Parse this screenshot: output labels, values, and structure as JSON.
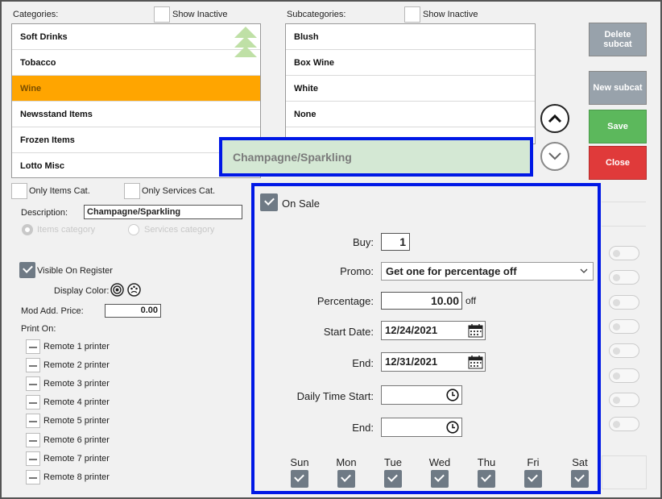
{
  "categories": {
    "header": "Categories:",
    "show_inactive": "Show Inactive",
    "items": [
      "Soft Drinks",
      "Tobacco",
      "Wine",
      "Newsstand Items",
      "Frozen Items",
      "Lotto Misc"
    ],
    "selected": "Wine"
  },
  "subcategories": {
    "header": "Subcategories:",
    "show_inactive": "Show Inactive",
    "items": [
      "Blush",
      "Box Wine",
      "White",
      "None"
    ]
  },
  "buttons": {
    "delete_subcat": "Delete subcat",
    "new_subcat": "New subcat",
    "save": "Save",
    "close": "Close"
  },
  "selected_subcat_banner": "Champagne/Sparkling",
  "filters": {
    "only_items": "Only Items Cat.",
    "only_services": "Only Services Cat."
  },
  "form": {
    "description_label": "Description:",
    "description_value": "Champagne/Sparkling",
    "items_category": "Items category",
    "services_category": "Services category",
    "visible_on_register": "Visible On Register",
    "display_color": "Display Color:",
    "mod_add_price_label": "Mod Add. Price:",
    "mod_add_price_value": "0.00",
    "print_on": "Print On:",
    "printers": [
      "Remote 1 printer",
      "Remote 2 printer",
      "Remote 3 printer",
      "Remote 4 printer",
      "Remote 5 printer",
      "Remote 6 printer",
      "Remote 7 printer",
      "Remote 8 printer"
    ]
  },
  "sale": {
    "on_sale": "On Sale",
    "buy_label": "Buy:",
    "buy_value": "1",
    "promo_label": "Promo:",
    "promo_value": "Get one for percentage off",
    "percentage_label": "Percentage:",
    "percentage_value": "10.00",
    "percentage_suffix": "off",
    "start_date_label": "Start Date:",
    "start_date_value": "12/24/2021",
    "end_date_label": "End:",
    "end_date_value": "12/31/2021",
    "daily_start_label": "Daily Time Start:",
    "daily_end_label": "End:",
    "days": [
      "Sun",
      "Mon",
      "Tue",
      "Wed",
      "Thu",
      "Fri",
      "Sat"
    ]
  },
  "colors": {
    "selected_row": "#ffa500",
    "save_button": "#5cb85c",
    "close_button": "#e03a3a",
    "gray_button": "#98a2ab",
    "popup_border": "#0018e6",
    "banner_bg": "#d4e8d4"
  }
}
